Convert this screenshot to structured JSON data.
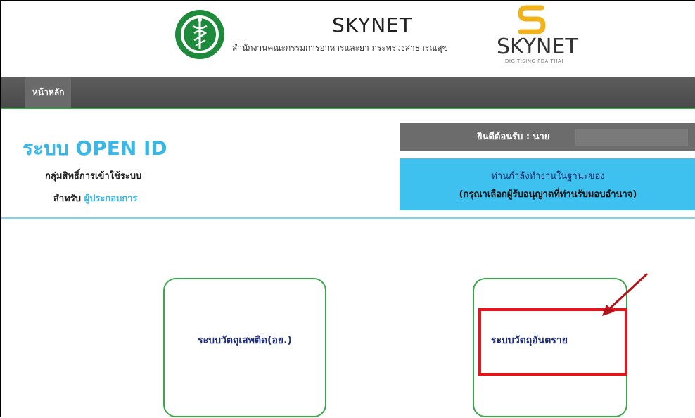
{
  "header": {
    "title": "SKYNET",
    "subtitle": "สำนักงานคณะกรรมการอาหารและยา กระทรวงสาธารณสุข",
    "logo_text": "SKYNET",
    "logo_tagline": "DIGITISING FDA THAI",
    "seal_icon": "ministry-of-public-health-seal-icon"
  },
  "nav": {
    "home_label": "หน้าหลัก"
  },
  "system": {
    "title": "ระบบ OPEN ID",
    "group_label": "กลุ่มสิทธิ์การเข้าใช้ระบบ",
    "for_prefix": "สำหรับ",
    "role": "ผู้ประกอบการ"
  },
  "welcome": {
    "label": "ยินดีต้อนรับ : นาย"
  },
  "info": {
    "line1": "ท่านกำลังทำงานในฐานะของ",
    "line2": "(กรุณาเลือกผู้รับอนุญาตที่ท่านรับมอบอำนาจ)"
  },
  "cards": [
    {
      "label": "ระบบวัตถุเสพติด(อย.)"
    },
    {
      "label": "ระบบวัตถุอันตราย"
    }
  ],
  "colors": {
    "accent_blue": "#39b7e6",
    "nav_gray": "#5d5d5d",
    "card_border_green": "#3aa84a",
    "highlight_red": "#e8141b",
    "card_text_navy": "#1c2a7a"
  }
}
